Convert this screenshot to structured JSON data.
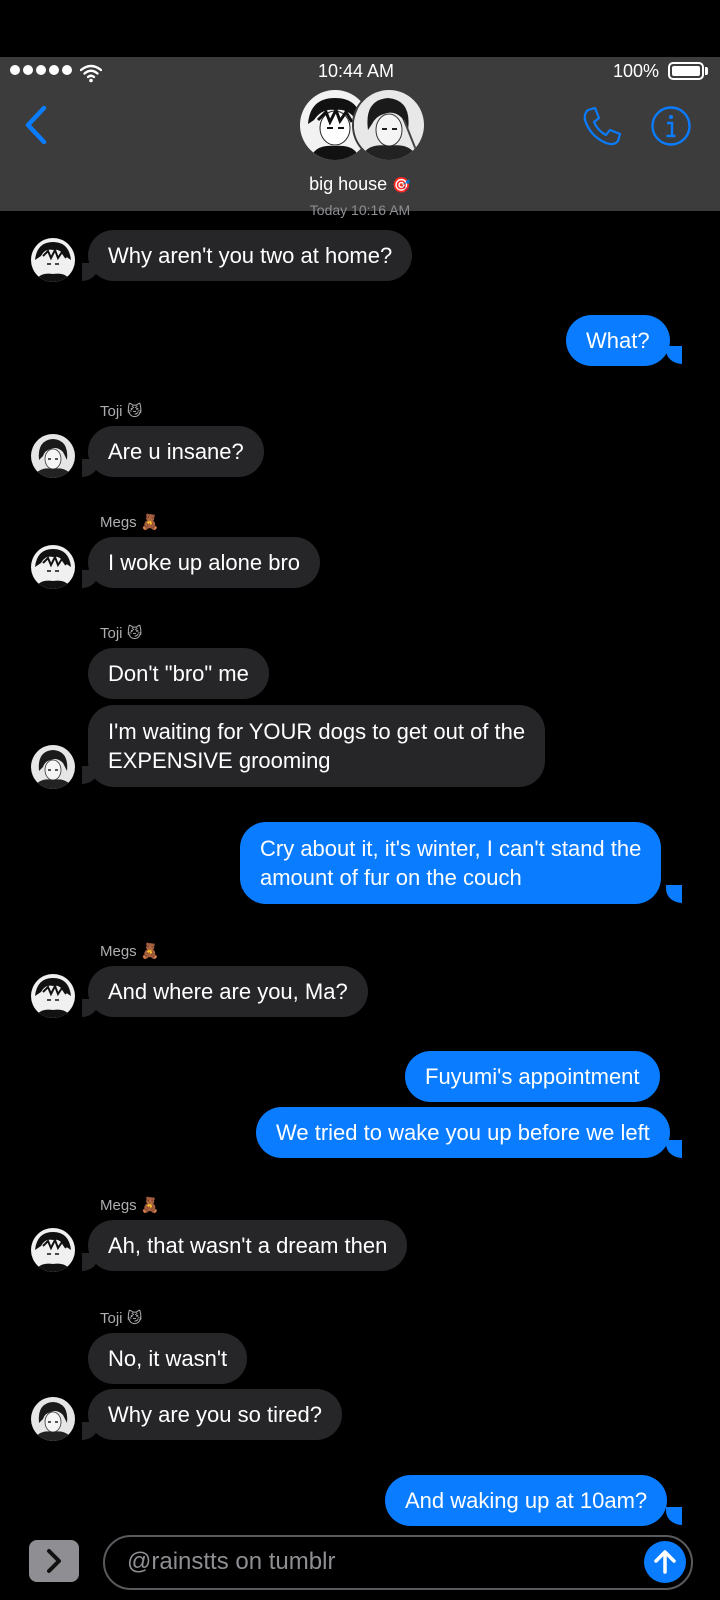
{
  "status_bar": {
    "time": "10:44 AM",
    "battery": "100%",
    "battery_level": 1.0
  },
  "header": {
    "group_name": "big house",
    "group_emoji": "🎯"
  },
  "timestamp_label": "Today 10:16 AM",
  "messages": [
    {
      "sender": "",
      "text": "Why aren't you two at home?",
      "outgoing": false
    },
    {
      "sender": "",
      "text": "What?",
      "outgoing": true
    },
    {
      "sender": "Toji",
      "emoji": "😼",
      "text": "Are u insane?",
      "outgoing": false
    },
    {
      "sender": "Megs",
      "emoji": "🧸",
      "text": "I woke up alone bro",
      "outgoing": false
    },
    {
      "sender": "Toji",
      "emoji": "😼",
      "text": "Don't \"bro\" me",
      "outgoing": false
    },
    {
      "sender": "",
      "text_lines": [
        "I'm waiting for YOUR dogs to get out of the",
        "EXPENSIVE grooming"
      ],
      "outgoing": false
    },
    {
      "sender": "",
      "text_lines": [
        "Cry about it, it's winter, I can't stand the",
        "amount of fur on the couch"
      ],
      "outgoing": true
    },
    {
      "sender": "Megs",
      "emoji": "🧸",
      "text": "And where are you, Ma?",
      "outgoing": false
    },
    {
      "sender": "",
      "text": "Fuyumi's appointment",
      "outgoing": true
    },
    {
      "sender": "",
      "text": "We tried to wake you up before we left",
      "outgoing": true
    },
    {
      "sender": "Megs",
      "emoji": "🧸",
      "text": "Ah, that wasn't a dream then",
      "outgoing": false
    },
    {
      "sender": "Toji",
      "emoji": "😼",
      "text": "No, it wasn't",
      "outgoing": false
    },
    {
      "sender": "",
      "text": "Why are you so tired?",
      "outgoing": false
    },
    {
      "sender": "",
      "text": "And waking up at 10am?",
      "outgoing": true
    }
  ],
  "composer": {
    "placeholder": "@rainstts on tumblr"
  },
  "colors": {
    "accent": "#0a7cff",
    "incoming_bubble": "#262629",
    "header_bg": "#3c3c3c"
  }
}
